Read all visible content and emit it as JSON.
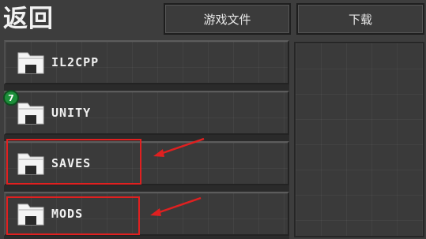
{
  "header": {
    "back_label": "返回",
    "tabs": [
      {
        "label": "游戏文件"
      },
      {
        "label": "下载"
      }
    ]
  },
  "file_list": {
    "items": [
      {
        "label": "IL2CPP",
        "icon": "folder-icon"
      },
      {
        "label": "UNITY",
        "icon": "folder-icon",
        "badge": "7"
      },
      {
        "label": "SAVES",
        "icon": "folder-icon",
        "highlighted": true
      },
      {
        "label": "MODS",
        "icon": "folder-icon",
        "highlighted": true
      }
    ]
  },
  "colors": {
    "highlight": "#e02020",
    "badge": "#1d8f3a",
    "background": "#3d3d3d"
  }
}
